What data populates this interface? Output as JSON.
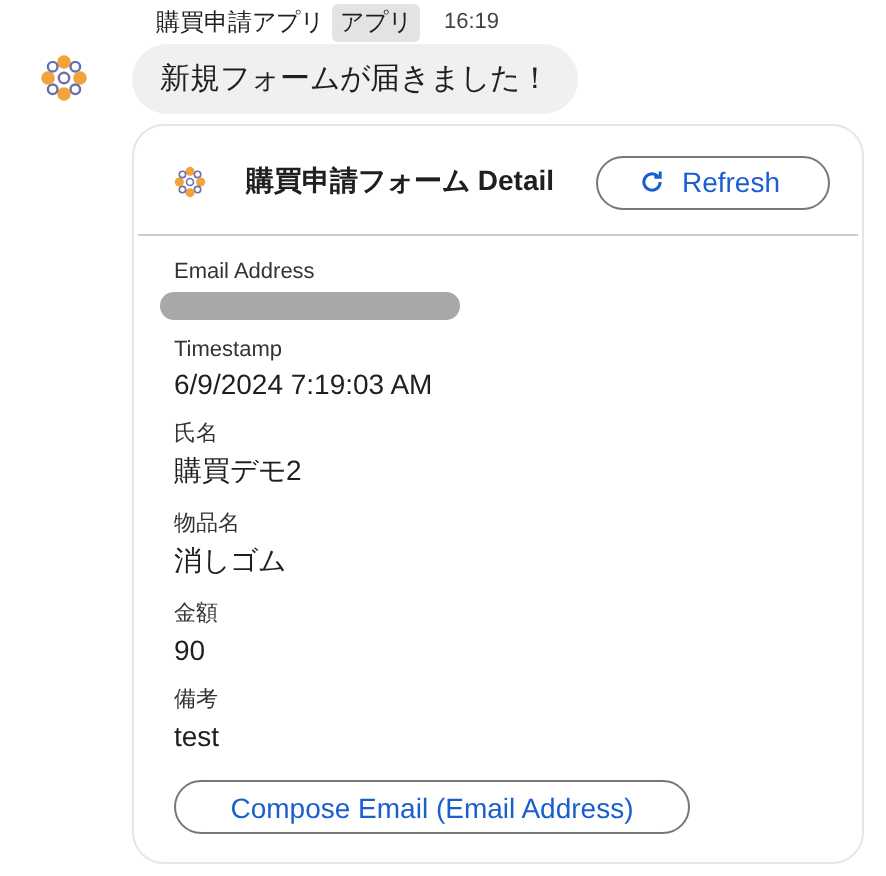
{
  "message": {
    "sender": "購買申請アプリ",
    "badge": "アプリ",
    "time": "16:19",
    "text": "新規フォームが届きました！"
  },
  "card": {
    "title": "購買申請フォーム Detail",
    "refresh_button": "Refresh",
    "fields": [
      {
        "label": "Email Address",
        "kind": "redacted"
      },
      {
        "label": "Timestamp",
        "kind": "text",
        "value": "6/9/2024 7:19:03 AM"
      },
      {
        "label": "氏名",
        "kind": "text",
        "value": "購買デモ2"
      },
      {
        "label": "物品名",
        "kind": "text",
        "value": "消しゴム"
      },
      {
        "label": "金額",
        "kind": "text",
        "value": "90"
      },
      {
        "label": "備考",
        "kind": "text",
        "value": "test"
      }
    ],
    "action_button": "Compose Email (Email Address)"
  }
}
